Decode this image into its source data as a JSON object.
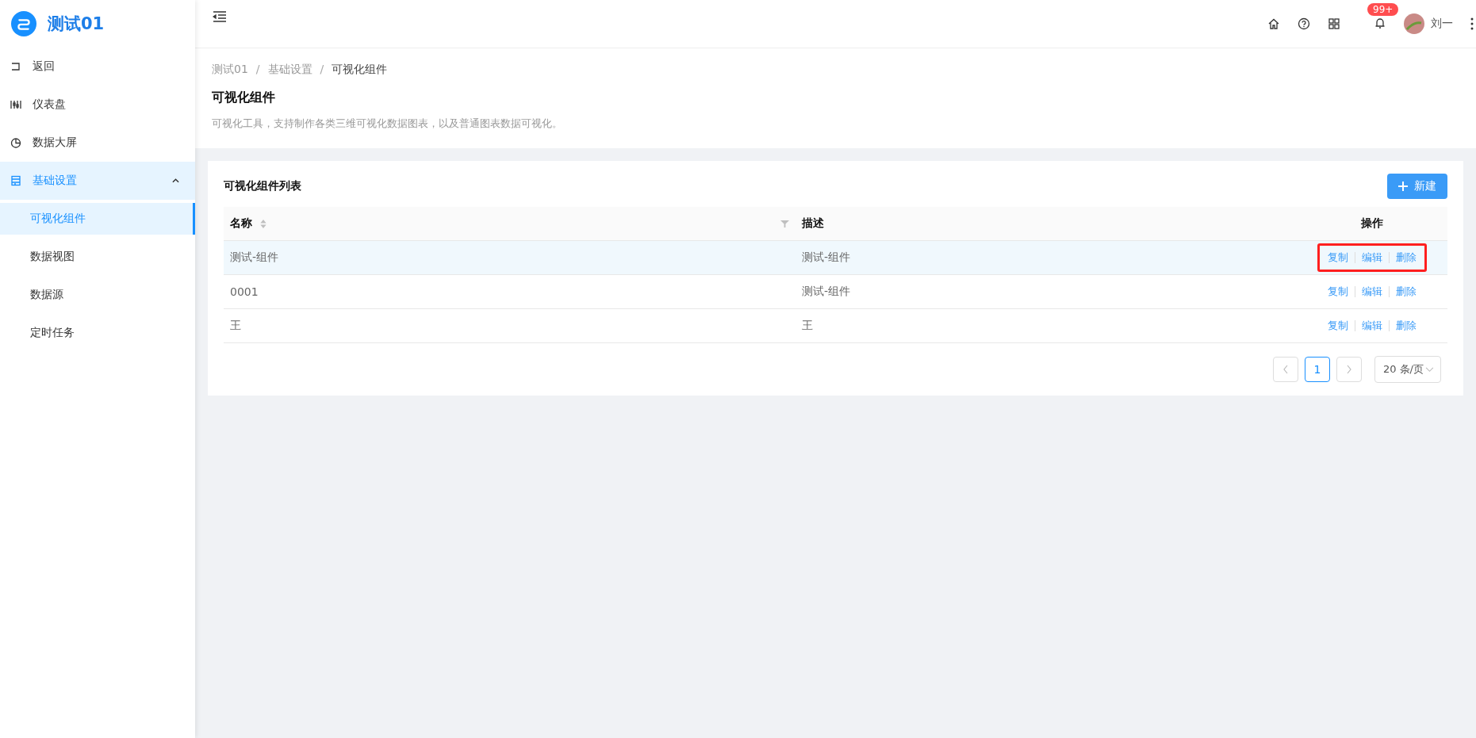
{
  "sidebar": {
    "logo": "测试01",
    "items": [
      {
        "label": "返回",
        "selected": false
      },
      {
        "label": "仪表盘",
        "selected": false
      },
      {
        "label": "数据大屏",
        "selected": false
      },
      {
        "label": "基础设置",
        "selected": true,
        "expanded": true,
        "children": [
          {
            "label": "可视化组件",
            "selected": true
          },
          {
            "label": "数据视图",
            "selected": false
          },
          {
            "label": "数据源",
            "selected": false
          },
          {
            "label": "定时任务",
            "selected": false
          }
        ]
      }
    ]
  },
  "header": {
    "notification_badge": "99+",
    "user": "刘一"
  },
  "breadcrumb": {
    "separator": "/",
    "items": [
      "测试01",
      "基础设置",
      "可视化组件"
    ]
  },
  "page": {
    "title": "可视化组件",
    "description": "可视化工具，支持制作各类三维可视化数据图表，以及普通图表数据可视化。"
  },
  "card": {
    "title": "可视化组件列表",
    "new_button": "新建",
    "table": {
      "columns": [
        "名称",
        "描述",
        "操作"
      ],
      "rows": [
        {
          "name": "测试-组件",
          "description": "测试-组件",
          "actions": [
            "复制",
            "编辑",
            "删除"
          ],
          "hovered": true,
          "outlined": true
        },
        {
          "name": "0001",
          "description": "测试-组件",
          "actions": [
            "复制",
            "编辑",
            "删除"
          ],
          "hovered": false,
          "outlined": false
        },
        {
          "name": "王",
          "description": "王",
          "actions": [
            "复制",
            "编辑",
            "删除"
          ],
          "hovered": false,
          "outlined": false
        }
      ]
    },
    "pagination": {
      "pages": [
        {
          "label": "1",
          "selected": true
        }
      ],
      "page_size": "20 条/页"
    }
  }
}
